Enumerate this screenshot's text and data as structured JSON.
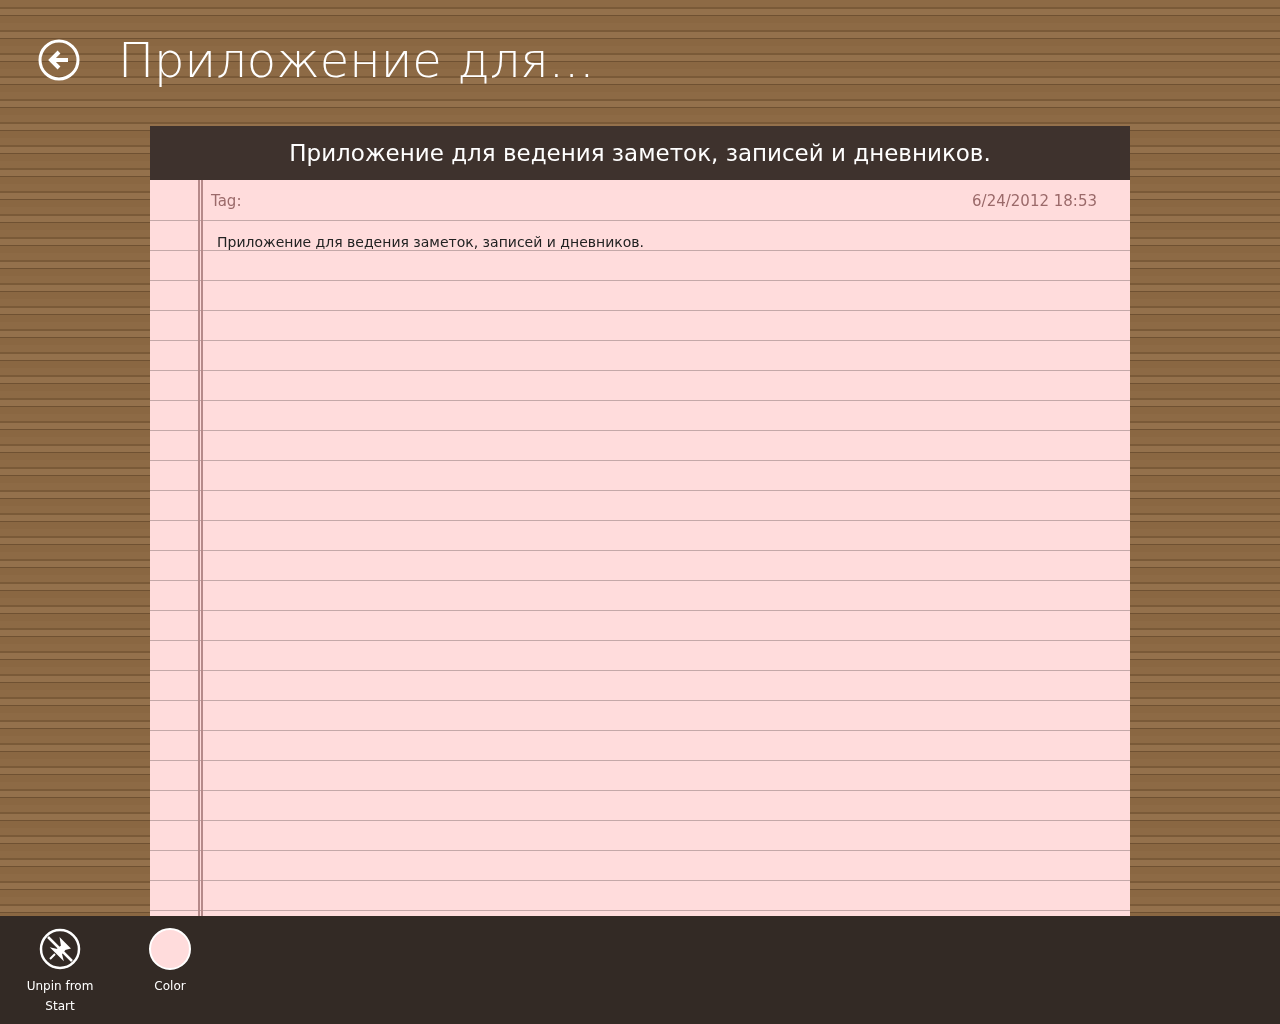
{
  "header": {
    "title": "Приложение для..."
  },
  "note": {
    "title": "Приложение для ведения заметок, записей и дневников.",
    "tag_label": "Tag:",
    "date": "6/24/2012 18:53",
    "text": "Приложение для ведения заметок, записей и дневников."
  },
  "app_bar": {
    "buttons": [
      {
        "kind": "unpin",
        "label": "Unpin from Start"
      },
      {
        "kind": "color",
        "label": "Color",
        "color": "#ffdcdc"
      }
    ]
  }
}
